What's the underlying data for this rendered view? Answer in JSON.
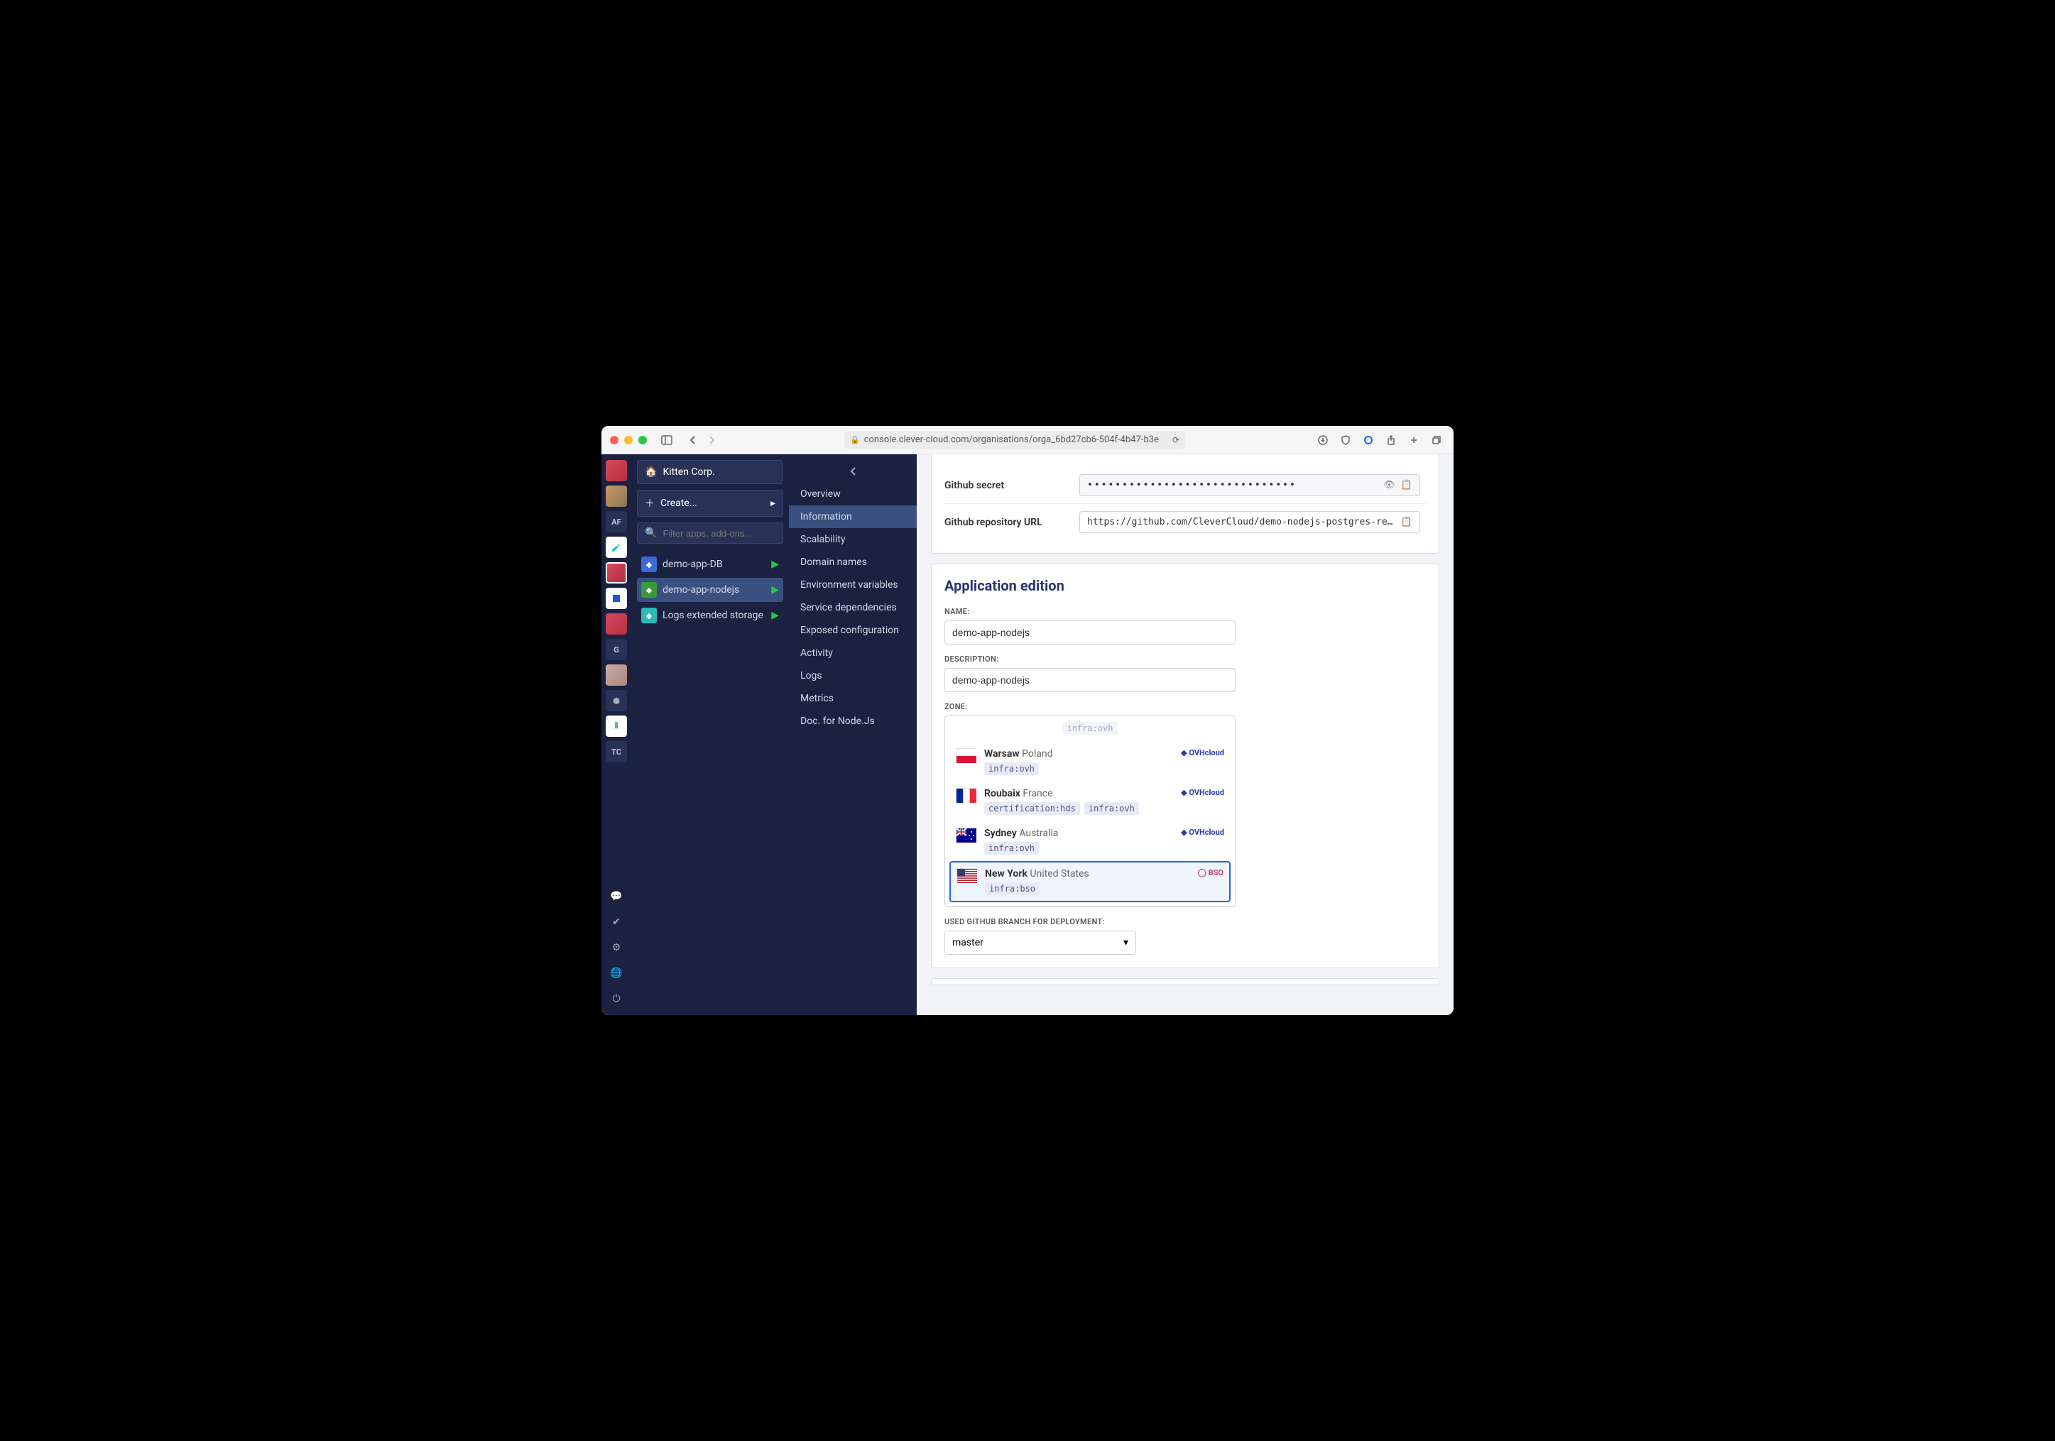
{
  "browser": {
    "url": "console.clever-cloud.com/organisations/orga_6bd27cb6-504f-4b47-b3e"
  },
  "org": {
    "name": "Kitten Corp.",
    "create_label": "Create...",
    "search_placeholder": "Filter apps, add-ons..."
  },
  "apps": [
    {
      "name": "demo-app-DB",
      "icon": "db",
      "active": false
    },
    {
      "name": "demo-app-nodejs",
      "icon": "node",
      "active": true
    },
    {
      "name": "Logs extended storage",
      "icon": "logs",
      "active": false
    }
  ],
  "rail_text": {
    "af": "AF",
    "g": "G",
    "tc": "TC"
  },
  "menu": {
    "items": [
      "Overview",
      "Information",
      "Scalability",
      "Domain names",
      "Environment variables",
      "Service dependencies",
      "Exposed configuration",
      "Activity",
      "Logs",
      "Metrics",
      "Doc. for Node.Js"
    ],
    "active": "Information"
  },
  "top_fields": {
    "github_secret_label": "Github secret",
    "github_secret_value": "••••••••••••••••••••••••••••••",
    "github_url_label": "Github repository URL",
    "github_url_value": "https://github.com/CleverCloud/demo-nodejs-postgres-rest.g"
  },
  "edition": {
    "title": "Application edition",
    "name_label": "Name:",
    "name_value": "demo-app-nodejs",
    "desc_label": "Description:",
    "desc_value": "demo-app-nodejs",
    "zone_label": "Zone:",
    "zones": [
      {
        "city": "Warsaw",
        "country": "Poland",
        "flag": "pl",
        "tags": [
          "infra:ovh"
        ],
        "provider": "OVHcloud",
        "selected": false
      },
      {
        "city": "Roubaix",
        "country": "France",
        "flag": "fr",
        "tags": [
          "certification:hds",
          "infra:ovh"
        ],
        "provider": "OVHcloud",
        "selected": false
      },
      {
        "city": "Sydney",
        "country": "Australia",
        "flag": "au",
        "tags": [
          "infra:ovh"
        ],
        "provider": "OVHcloud",
        "selected": false
      },
      {
        "city": "New York",
        "country": "United States",
        "flag": "us",
        "tags": [
          "infra:bso"
        ],
        "provider": "BSO",
        "selected": true
      }
    ],
    "partial_tag": "infra:ovh",
    "branch_label": "Used Github branch for deployment:",
    "branch_value": "master"
  }
}
